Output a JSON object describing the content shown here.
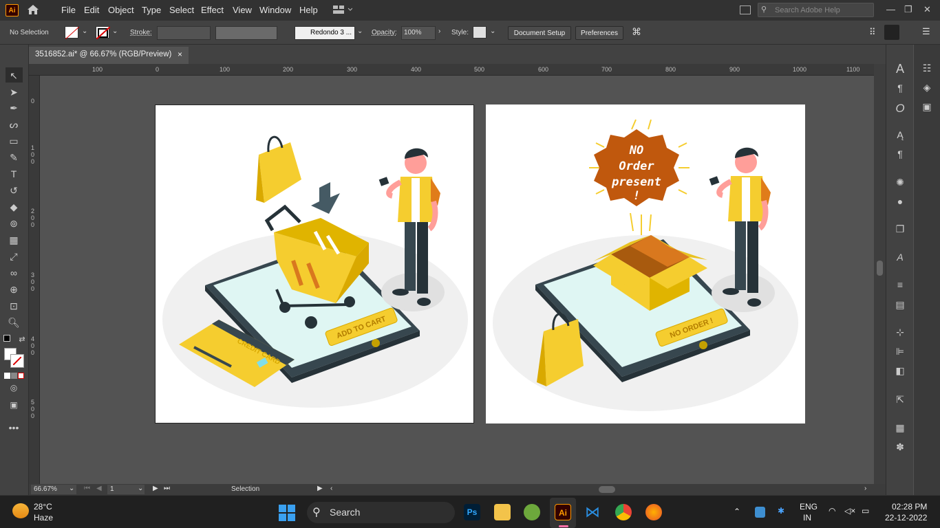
{
  "app": {
    "logo": "Ai",
    "search_placeholder": "Search Adobe Help"
  },
  "menu": [
    "File",
    "Edit",
    "Object",
    "Type",
    "Select",
    "Effect",
    "View",
    "Window",
    "Help"
  ],
  "control": {
    "selection": "No Selection",
    "stroke_label": "Stroke:",
    "brush": "Redondo 3 ...",
    "opacity_label": "Opacity:",
    "opacity_value": "100%",
    "style_label": "Style:",
    "doc_setup": "Document Setup",
    "preferences": "Preferences"
  },
  "tab": {
    "title": "3516852.ai* @ 66.67% (RGB/Preview)",
    "close": "×"
  },
  "ruler_h": [
    "100",
    "0",
    "100",
    "200",
    "300",
    "400",
    "500",
    "600",
    "700",
    "800",
    "900",
    "1000",
    "1100"
  ],
  "ruler_v": [
    "0",
    "1\n0\n0",
    "2\n0\n0",
    "3\n0\n0",
    "4\n0\n0",
    "5\n0\n0"
  ],
  "artboard1": {
    "cart_label": "ADD TO CART",
    "card_label": "CREDIT CARD"
  },
  "artboard2": {
    "badge_lines": [
      "NO",
      "Order",
      "present",
      "!"
    ],
    "screen_label": "NO ORDER !"
  },
  "status": {
    "zoom": "66.67%",
    "artboard_num": "1",
    "tool": "Selection"
  },
  "taskbar": {
    "weather_temp": "28°C",
    "weather_desc": "Haze",
    "search": "Search",
    "lang1": "ENG",
    "lang2": "IN",
    "time": "02:28 PM",
    "date": "22-12-2022"
  },
  "colors": {
    "accent_yellow": "#f5cd2f",
    "accent_dark": "#3c4649",
    "badge_orange": "#c0580d"
  }
}
